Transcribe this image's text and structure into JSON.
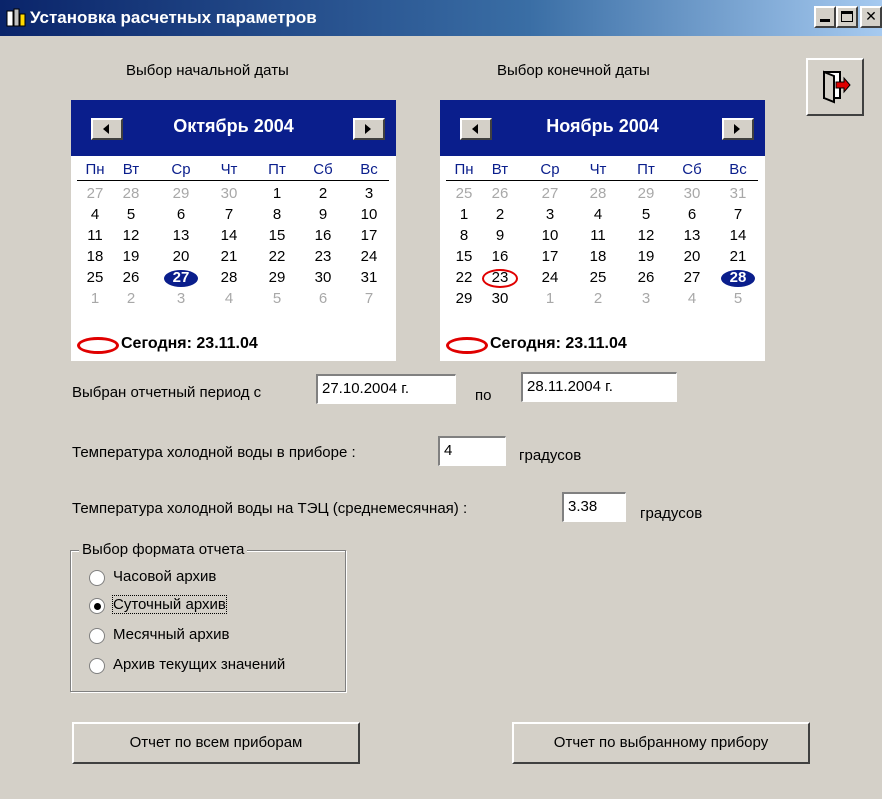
{
  "window": {
    "title": "Установка расчетных параметров"
  },
  "labels": {
    "start_date": "Выбор начальной даты",
    "end_date": "Выбор конечной даты"
  },
  "weekdays": [
    "Пн",
    "Вт",
    "Ср",
    "Чт",
    "Пт",
    "Сб",
    "Вс"
  ],
  "start_calendar": {
    "month_label": "Октябрь 2004",
    "days": [
      [
        "27",
        "28",
        "29",
        "30",
        "1",
        "2",
        "3"
      ],
      [
        "4",
        "5",
        "6",
        "7",
        "8",
        "9",
        "10"
      ],
      [
        "11",
        "12",
        "13",
        "14",
        "15",
        "16",
        "17"
      ],
      [
        "18",
        "19",
        "20",
        "21",
        "22",
        "23",
        "24"
      ],
      [
        "25",
        "26",
        "27",
        "28",
        "29",
        "30",
        "31"
      ],
      [
        "1",
        "2",
        "3",
        "4",
        "5",
        "6",
        "7"
      ]
    ],
    "selected_day": "27",
    "today_label": "Сегодня: 23.11.04"
  },
  "end_calendar": {
    "month_label": "Ноябрь 2004",
    "days": [
      [
        "25",
        "26",
        "27",
        "28",
        "29",
        "30",
        "31"
      ],
      [
        "1",
        "2",
        "3",
        "4",
        "5",
        "6",
        "7"
      ],
      [
        "8",
        "9",
        "10",
        "11",
        "12",
        "13",
        "14"
      ],
      [
        "15",
        "16",
        "17",
        "18",
        "19",
        "20",
        "21"
      ],
      [
        "22",
        "23",
        "24",
        "25",
        "26",
        "27",
        "28"
      ],
      [
        "29",
        "30",
        "1",
        "2",
        "3",
        "4",
        "5"
      ]
    ],
    "selected_day": "28",
    "today_day": "23",
    "today_label": "Сегодня: 23.11.04"
  },
  "period": {
    "label": "Выбран отчетный период  с",
    "from_value": "27.10.2004 г.",
    "to_label": "по",
    "to_value": "28.11.2004 г."
  },
  "temp_device": {
    "label": "Температура холодной воды в приборе :",
    "value": "4",
    "unit": "градусов"
  },
  "temp_tec": {
    "label": "Температура холодной воды на ТЭЦ (среднемесячная) :",
    "value": "3.38",
    "unit": "градусов"
  },
  "report_format": {
    "legend": "Выбор формата отчета",
    "options": [
      {
        "label": "Часовой   архив",
        "checked": false
      },
      {
        "label": "Суточный  архив",
        "checked": true
      },
      {
        "label": "Месячный архив",
        "checked": false
      },
      {
        "label": "Архив текущих значений",
        "checked": false
      }
    ]
  },
  "buttons": {
    "all_devices": "Отчет по всем приборам",
    "selected_device": "Отчет по выбранному прибору"
  },
  "colors": {
    "calendar_header": "#0a1e8c",
    "today_marker": "#e00000",
    "window_bg": "#d4d0c8"
  },
  "icons": {
    "app": "window-app-icon",
    "exit": "exit-door-icon"
  }
}
